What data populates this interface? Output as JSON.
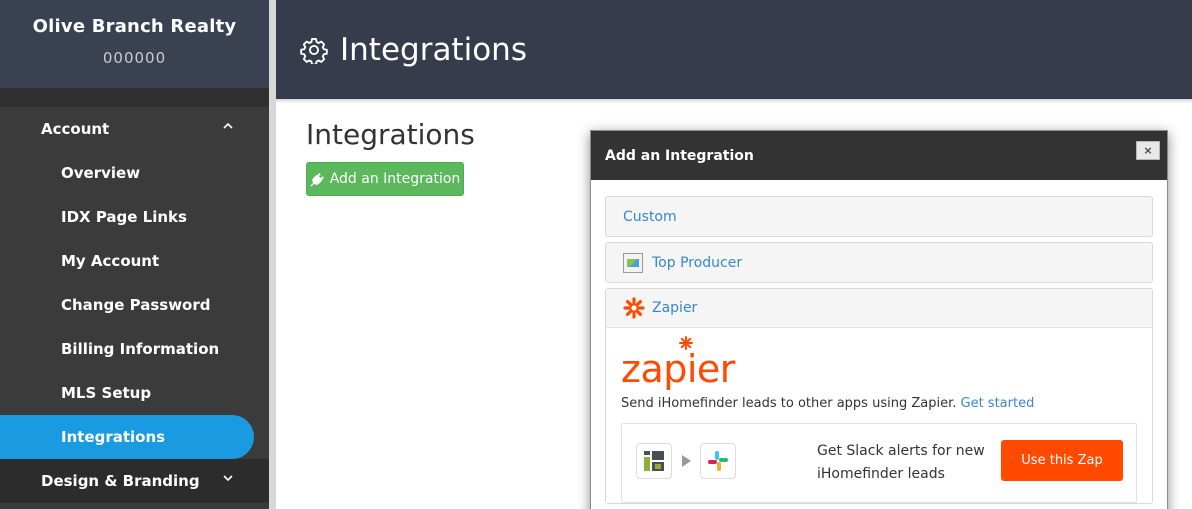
{
  "sidebar": {
    "brand_name": "Olive Branch Realty",
    "brand_id": "000000",
    "account_section": "Account",
    "items": [
      {
        "label": "Overview"
      },
      {
        "label": "IDX Page Links"
      },
      {
        "label": "My Account"
      },
      {
        "label": "Change Password"
      },
      {
        "label": "Billing Information"
      },
      {
        "label": "MLS Setup"
      },
      {
        "label": "Integrations"
      }
    ],
    "design_section": "Design & Branding",
    "active_color": "#1a9ae0"
  },
  "header": {
    "icon": "gear-icon",
    "title": "Integrations"
  },
  "main": {
    "title": "Integrations",
    "add_button": "Add an Integration",
    "add_button_color": "#5cb85c"
  },
  "modal": {
    "title": "Add an Integration",
    "close_label": "×",
    "panels": {
      "custom": "Custom",
      "top_producer": "Top Producer",
      "zapier": "Zapier"
    },
    "zapier": {
      "logo_text": "zapier",
      "description": "Send iHomefinder leads to other apps using Zapier.",
      "link": "Get started",
      "zap_text": "Get Slack alerts for new iHomefinder leads",
      "zap_button": "Use this Zap",
      "brand_color": "#ff4a00"
    }
  }
}
